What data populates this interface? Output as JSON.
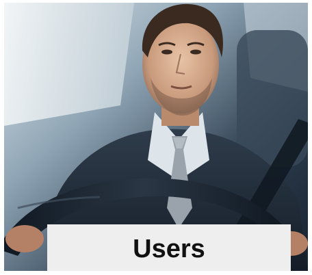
{
  "card": {
    "label": "Users",
    "image_description": "man-driving-car-photo"
  },
  "colors": {
    "label_background": "#eeeeee",
    "label_text": "#111111",
    "frame_background": "#1d2a38"
  }
}
